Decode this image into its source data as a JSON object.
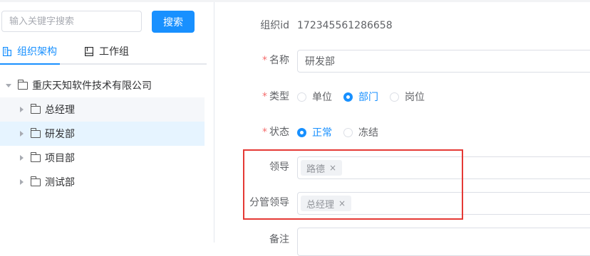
{
  "search": {
    "placeholder": "输入关键字搜索",
    "button_label": "搜索"
  },
  "tabs": [
    {
      "label": "组织架构",
      "icon": "org-structure-icon",
      "active": true
    },
    {
      "label": "工作组",
      "icon": "workgroup-icon",
      "active": false
    }
  ],
  "tree": {
    "root": {
      "label": "重庆天知软件技术有限公司",
      "icon": "folder-icon",
      "expanded": true
    },
    "children": [
      {
        "label": "总经理",
        "icon": "folder-icon"
      },
      {
        "label": "研发部",
        "icon": "folder-icon",
        "selected": true
      },
      {
        "label": "项目部",
        "icon": "folder-icon"
      },
      {
        "label": "测试部",
        "icon": "folder-icon"
      }
    ]
  },
  "form": {
    "org_id_label": "组织id",
    "org_id_value": "172345561286658",
    "name_label": "名称",
    "name_value": "研发部",
    "type_label": "类型",
    "type_options": [
      "单位",
      "部门",
      "岗位"
    ],
    "type_selected": "部门",
    "status_label": "状态",
    "status_options": [
      "正常",
      "冻结"
    ],
    "status_selected": "正常",
    "leader_label": "领导",
    "leader_tags": [
      "路德"
    ],
    "sub_leader_label": "分管领导",
    "sub_leader_tags": [
      "总经理"
    ],
    "remark_label": "备注",
    "required_mark": "*"
  },
  "colors": {
    "accent": "#1890ff",
    "required": "#f56c6c",
    "highlight_box": "#e53935"
  }
}
